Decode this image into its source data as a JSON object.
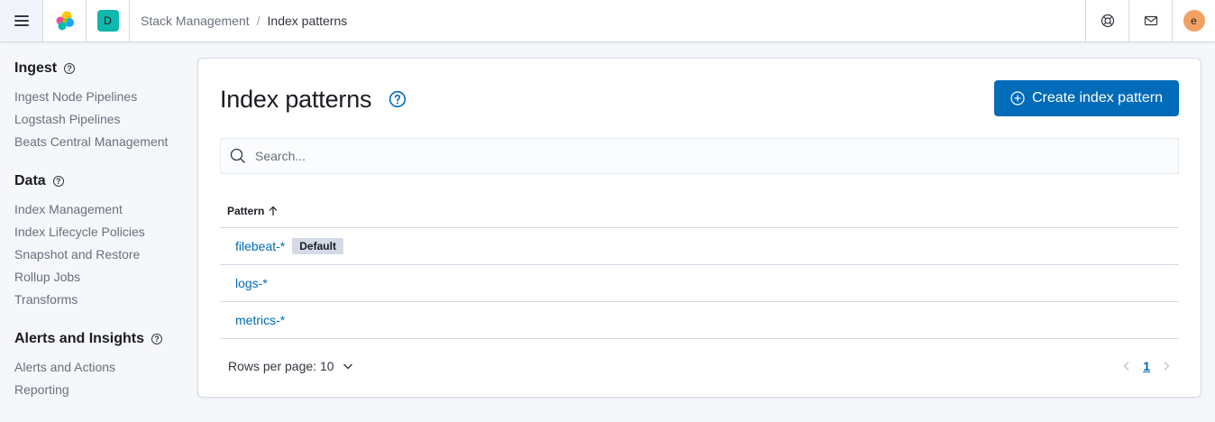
{
  "header": {
    "menu_icon": "hamburger-menu-icon",
    "logo_icon": "elastic-logo-icon",
    "space_initial": "D",
    "breadcrumbs": [
      "Stack Management",
      "Index patterns"
    ],
    "breadcrumb_separator": "/",
    "help_icon": "help-lifebuoy-icon",
    "news_icon": "newsfeed-mail-icon",
    "user_initial": "e"
  },
  "sidebar": {
    "groups": [
      {
        "title": "Ingest",
        "items": [
          "Ingest Node Pipelines",
          "Logstash Pipelines",
          "Beats Central Management"
        ]
      },
      {
        "title": "Data",
        "items": [
          "Index Management",
          "Index Lifecycle Policies",
          "Snapshot and Restore",
          "Rollup Jobs",
          "Transforms"
        ]
      },
      {
        "title": "Alerts and Insights",
        "items": [
          "Alerts and Actions",
          "Reporting"
        ]
      }
    ]
  },
  "main": {
    "title": "Index patterns",
    "create_label": "Create index pattern",
    "search_placeholder": "Search...",
    "table": {
      "column": "Pattern",
      "sort": "ascending",
      "rows": [
        {
          "pattern": "filebeat-*",
          "badge": "Default"
        },
        {
          "pattern": "logs-*"
        },
        {
          "pattern": "metrics-*"
        }
      ]
    },
    "rows_per_page": "Rows per page: 10",
    "current_page": "1"
  },
  "colors": {
    "primary": "#006bb8",
    "space_badge": "#0fb8ad",
    "avatar": "#f1a163",
    "border": "#d3dae6"
  }
}
